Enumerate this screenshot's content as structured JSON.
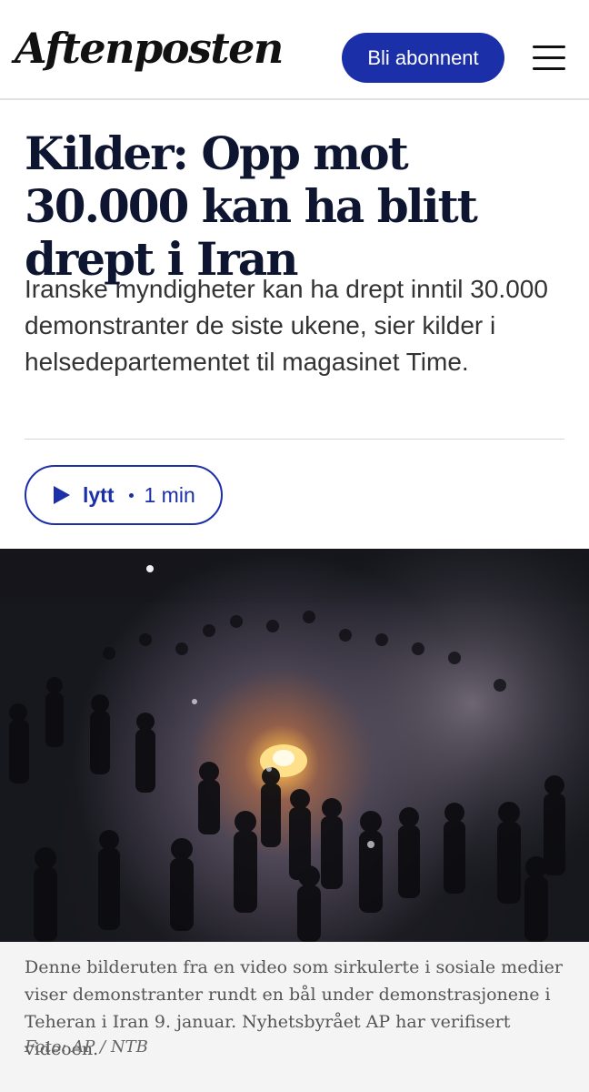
{
  "header": {
    "logo": "Aftenposten",
    "subscribe_label": "Bli abonnent",
    "menu_icon": "hamburger-menu-icon",
    "brand_color": "#1a2fa8"
  },
  "article": {
    "headline": "Kilder: Opp mot 30.000 kan ha blitt drept i Iran",
    "lead": "Iranske myndigheter kan ha drept inntil 30.000 demonstranter de siste ukene, sier kilder i helsedepartementet til magasinet Time.",
    "listen": {
      "label": "lytt",
      "duration": "1 min",
      "icon": "play-icon"
    },
    "image": {
      "caption": "Denne bilderuten fra en video som sirkulerte i sosiale medier viser demonstranter rundt en bål under demonstrasjonene i Teheran i Iran 9. januar. Nyhetsbyrået AP har verifisert videoen.",
      "credit": "Foto: AP / NTB"
    }
  }
}
